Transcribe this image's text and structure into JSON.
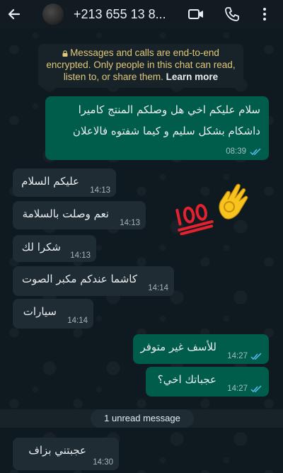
{
  "header": {
    "contact_name": "+213 655 13 8...",
    "icons": [
      "back-arrow-icon",
      "video-call-icon",
      "voice-call-icon",
      "more-options-icon"
    ]
  },
  "encryption_notice": {
    "text": "Messages and calls are end-to-end encrypted. Only people in this chat can read, listen to, or share them.",
    "link": "Learn more"
  },
  "messages": [
    {
      "direction": "outgoing",
      "lines": [
        "سلام عليكم اخي هل وصلكم المنتج كاميرا",
        "داشكام بشكل سليم و كيما شفتوه فالاعلان"
      ],
      "time": "08:39",
      "status": "read"
    },
    {
      "direction": "incoming",
      "text": "عليكم السلام",
      "time": "14:13"
    },
    {
      "direction": "incoming",
      "text": "نعم وصلت بالسلامة",
      "time": "14:13"
    },
    {
      "direction": "incoming",
      "text": "شكرا لك",
      "time": "14:13"
    },
    {
      "direction": "incoming",
      "text": "كاشما عندكم مكبر الصوت",
      "time": "14:14"
    },
    {
      "direction": "incoming",
      "text": "سيارات",
      "time": "14:14"
    },
    {
      "direction": "outgoing",
      "text": "للأسف غير متوفر",
      "time": "14:27",
      "status": "read"
    },
    {
      "direction": "outgoing",
      "text": "عجباتك اخي؟",
      "time": "14:27",
      "status": "read"
    },
    {
      "direction": "incoming",
      "text": "عجبتني بزاف",
      "time": "14:30"
    }
  ],
  "reactions": [
    "100-emoji-icon",
    "ok-hand-emoji-icon"
  ],
  "unread_divider": "1 unread message",
  "colors": {
    "header_bg": "#111b21",
    "chat_bg": "#0b141a",
    "outgoing_bubble": "#005c4b",
    "incoming_bubble": "#202c33",
    "read_ticks": "#53bdeb",
    "notice_text": "#e0c979"
  }
}
